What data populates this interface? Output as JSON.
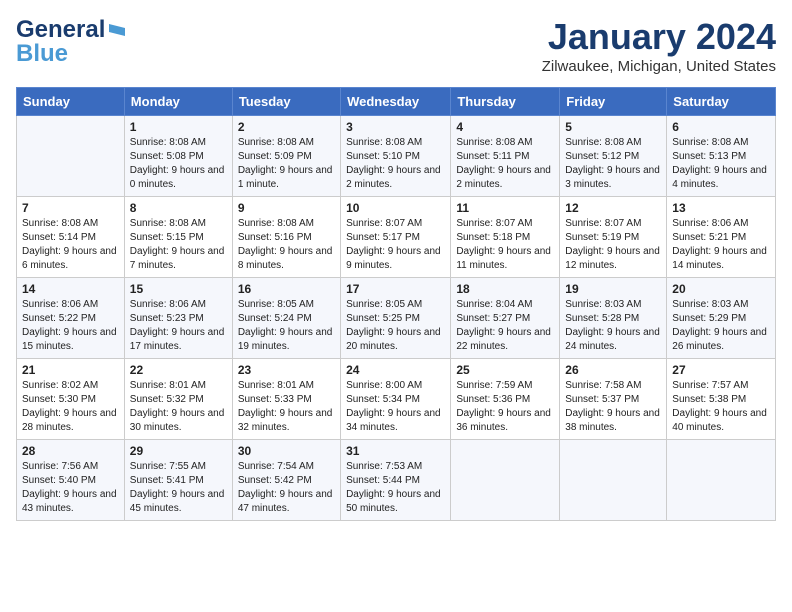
{
  "header": {
    "logo": {
      "line1": "General",
      "line2": "Blue"
    },
    "title": "January 2024",
    "location": "Zilwaukee, Michigan, United States"
  },
  "weekdays": [
    "Sunday",
    "Monday",
    "Tuesday",
    "Wednesday",
    "Thursday",
    "Friday",
    "Saturday"
  ],
  "weeks": [
    [
      {
        "day": "",
        "sunrise": "",
        "sunset": "",
        "daylight": ""
      },
      {
        "day": "1",
        "sunrise": "Sunrise: 8:08 AM",
        "sunset": "Sunset: 5:08 PM",
        "daylight": "Daylight: 9 hours and 0 minutes."
      },
      {
        "day": "2",
        "sunrise": "Sunrise: 8:08 AM",
        "sunset": "Sunset: 5:09 PM",
        "daylight": "Daylight: 9 hours and 1 minute."
      },
      {
        "day": "3",
        "sunrise": "Sunrise: 8:08 AM",
        "sunset": "Sunset: 5:10 PM",
        "daylight": "Daylight: 9 hours and 2 minutes."
      },
      {
        "day": "4",
        "sunrise": "Sunrise: 8:08 AM",
        "sunset": "Sunset: 5:11 PM",
        "daylight": "Daylight: 9 hours and 2 minutes."
      },
      {
        "day": "5",
        "sunrise": "Sunrise: 8:08 AM",
        "sunset": "Sunset: 5:12 PM",
        "daylight": "Daylight: 9 hours and 3 minutes."
      },
      {
        "day": "6",
        "sunrise": "Sunrise: 8:08 AM",
        "sunset": "Sunset: 5:13 PM",
        "daylight": "Daylight: 9 hours and 4 minutes."
      }
    ],
    [
      {
        "day": "7",
        "sunrise": "Sunrise: 8:08 AM",
        "sunset": "Sunset: 5:14 PM",
        "daylight": "Daylight: 9 hours and 6 minutes."
      },
      {
        "day": "8",
        "sunrise": "Sunrise: 8:08 AM",
        "sunset": "Sunset: 5:15 PM",
        "daylight": "Daylight: 9 hours and 7 minutes."
      },
      {
        "day": "9",
        "sunrise": "Sunrise: 8:08 AM",
        "sunset": "Sunset: 5:16 PM",
        "daylight": "Daylight: 9 hours and 8 minutes."
      },
      {
        "day": "10",
        "sunrise": "Sunrise: 8:07 AM",
        "sunset": "Sunset: 5:17 PM",
        "daylight": "Daylight: 9 hours and 9 minutes."
      },
      {
        "day": "11",
        "sunrise": "Sunrise: 8:07 AM",
        "sunset": "Sunset: 5:18 PM",
        "daylight": "Daylight: 9 hours and 11 minutes."
      },
      {
        "day": "12",
        "sunrise": "Sunrise: 8:07 AM",
        "sunset": "Sunset: 5:19 PM",
        "daylight": "Daylight: 9 hours and 12 minutes."
      },
      {
        "day": "13",
        "sunrise": "Sunrise: 8:06 AM",
        "sunset": "Sunset: 5:21 PM",
        "daylight": "Daylight: 9 hours and 14 minutes."
      }
    ],
    [
      {
        "day": "14",
        "sunrise": "Sunrise: 8:06 AM",
        "sunset": "Sunset: 5:22 PM",
        "daylight": "Daylight: 9 hours and 15 minutes."
      },
      {
        "day": "15",
        "sunrise": "Sunrise: 8:06 AM",
        "sunset": "Sunset: 5:23 PM",
        "daylight": "Daylight: 9 hours and 17 minutes."
      },
      {
        "day": "16",
        "sunrise": "Sunrise: 8:05 AM",
        "sunset": "Sunset: 5:24 PM",
        "daylight": "Daylight: 9 hours and 19 minutes."
      },
      {
        "day": "17",
        "sunrise": "Sunrise: 8:05 AM",
        "sunset": "Sunset: 5:25 PM",
        "daylight": "Daylight: 9 hours and 20 minutes."
      },
      {
        "day": "18",
        "sunrise": "Sunrise: 8:04 AM",
        "sunset": "Sunset: 5:27 PM",
        "daylight": "Daylight: 9 hours and 22 minutes."
      },
      {
        "day": "19",
        "sunrise": "Sunrise: 8:03 AM",
        "sunset": "Sunset: 5:28 PM",
        "daylight": "Daylight: 9 hours and 24 minutes."
      },
      {
        "day": "20",
        "sunrise": "Sunrise: 8:03 AM",
        "sunset": "Sunset: 5:29 PM",
        "daylight": "Daylight: 9 hours and 26 minutes."
      }
    ],
    [
      {
        "day": "21",
        "sunrise": "Sunrise: 8:02 AM",
        "sunset": "Sunset: 5:30 PM",
        "daylight": "Daylight: 9 hours and 28 minutes."
      },
      {
        "day": "22",
        "sunrise": "Sunrise: 8:01 AM",
        "sunset": "Sunset: 5:32 PM",
        "daylight": "Daylight: 9 hours and 30 minutes."
      },
      {
        "day": "23",
        "sunrise": "Sunrise: 8:01 AM",
        "sunset": "Sunset: 5:33 PM",
        "daylight": "Daylight: 9 hours and 32 minutes."
      },
      {
        "day": "24",
        "sunrise": "Sunrise: 8:00 AM",
        "sunset": "Sunset: 5:34 PM",
        "daylight": "Daylight: 9 hours and 34 minutes."
      },
      {
        "day": "25",
        "sunrise": "Sunrise: 7:59 AM",
        "sunset": "Sunset: 5:36 PM",
        "daylight": "Daylight: 9 hours and 36 minutes."
      },
      {
        "day": "26",
        "sunrise": "Sunrise: 7:58 AM",
        "sunset": "Sunset: 5:37 PM",
        "daylight": "Daylight: 9 hours and 38 minutes."
      },
      {
        "day": "27",
        "sunrise": "Sunrise: 7:57 AM",
        "sunset": "Sunset: 5:38 PM",
        "daylight": "Daylight: 9 hours and 40 minutes."
      }
    ],
    [
      {
        "day": "28",
        "sunrise": "Sunrise: 7:56 AM",
        "sunset": "Sunset: 5:40 PM",
        "daylight": "Daylight: 9 hours and 43 minutes."
      },
      {
        "day": "29",
        "sunrise": "Sunrise: 7:55 AM",
        "sunset": "Sunset: 5:41 PM",
        "daylight": "Daylight: 9 hours and 45 minutes."
      },
      {
        "day": "30",
        "sunrise": "Sunrise: 7:54 AM",
        "sunset": "Sunset: 5:42 PM",
        "daylight": "Daylight: 9 hours and 47 minutes."
      },
      {
        "day": "31",
        "sunrise": "Sunrise: 7:53 AM",
        "sunset": "Sunset: 5:44 PM",
        "daylight": "Daylight: 9 hours and 50 minutes."
      },
      {
        "day": "",
        "sunrise": "",
        "sunset": "",
        "daylight": ""
      },
      {
        "day": "",
        "sunrise": "",
        "sunset": "",
        "daylight": ""
      },
      {
        "day": "",
        "sunrise": "",
        "sunset": "",
        "daylight": ""
      }
    ]
  ]
}
